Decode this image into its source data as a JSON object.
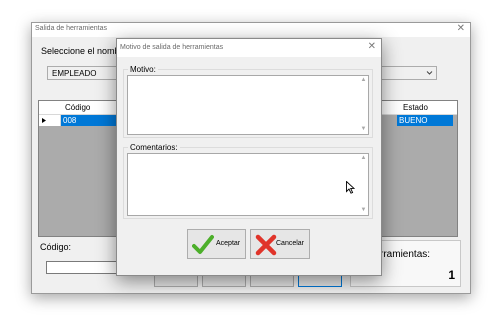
{
  "main_window": {
    "title": "Salida de herramientas",
    "select_label": "Seleccione el nombre",
    "type_value": "EMPLEADO",
    "grid": {
      "columns": {
        "codigo": "Código",
        "estado": "Estado"
      },
      "row": {
        "codigo": "008",
        "estado": "BUENO"
      }
    },
    "codigo_label": "Código:",
    "total_label": "de herramientas:",
    "total_value": "1"
  },
  "dialog": {
    "title": "Motivo de salida de herramientas",
    "motivo_label": "Motivo:",
    "comentarios_label": "Comentarios:",
    "aceptar_label": "Aceptar",
    "cancelar_label": "Cancelar"
  },
  "colors": {
    "selection": "#0078d7",
    "accept_check": "#4caf2a",
    "cancel_x": "#e0342a"
  },
  "icons": [
    "close-icon",
    "dropdown-arrow-icon",
    "row-pointer-icon",
    "check-icon",
    "cancel-x-icon",
    "mouse-cursor-icon"
  ]
}
